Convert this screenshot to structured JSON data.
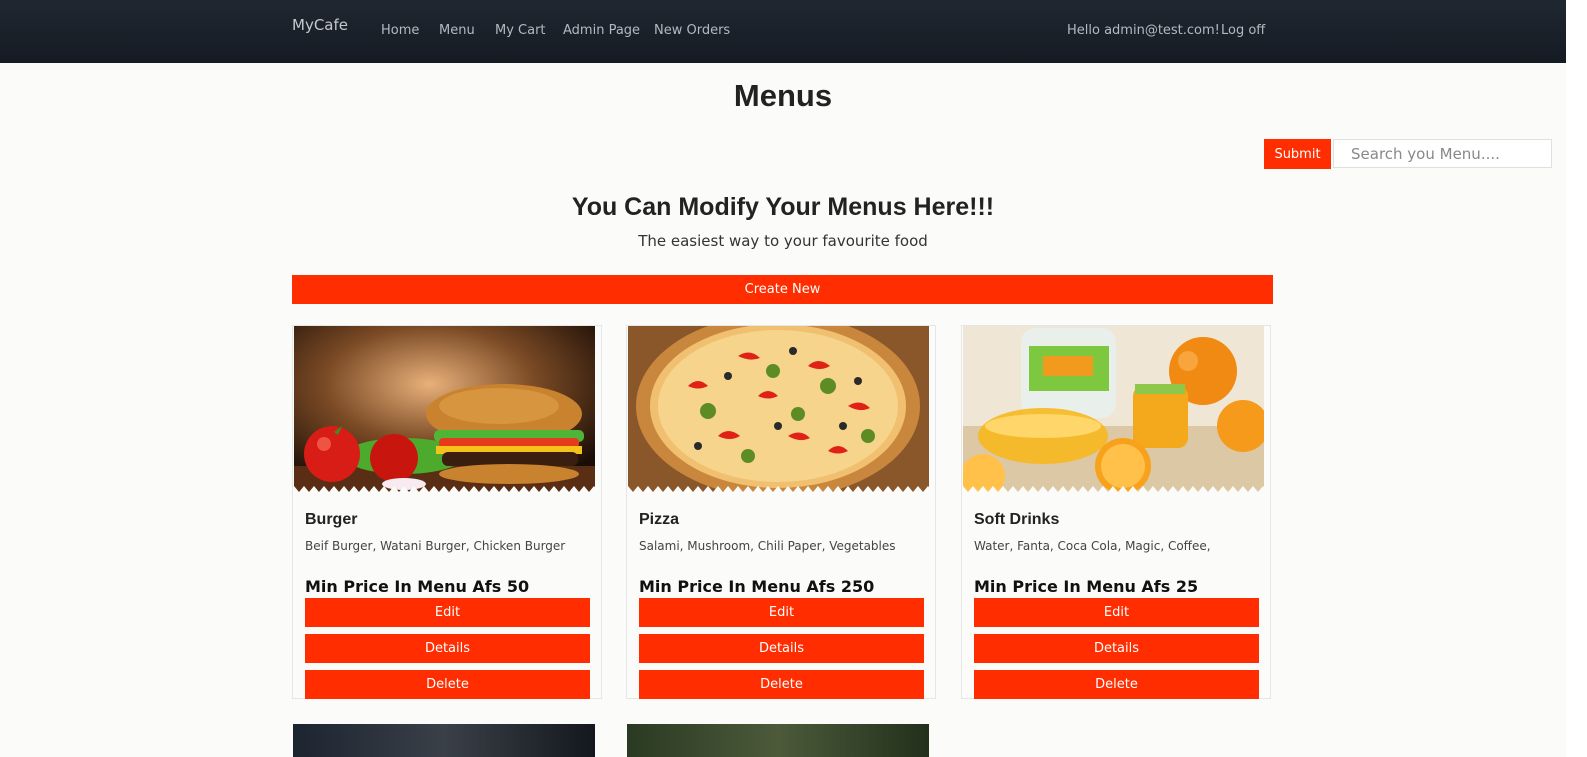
{
  "nav": {
    "brand": "MyCafe",
    "links": [
      "Home",
      "Menu",
      "My Cart",
      "Admin Page",
      "New Orders"
    ],
    "greeting": "Hello admin@test.com!",
    "logoff": "Log off"
  },
  "page": {
    "title": "Menus",
    "search_button": "Submit",
    "search_placeholder": "Search you Menu....",
    "hero_title": "You Can Modify Your Menus Here!!!",
    "hero_subtitle": "The easiest way to your favourite food",
    "create_button": "Create New"
  },
  "menus": [
    {
      "name": "Burger",
      "items": "Beif Burger, Watani Burger, Chicken Burger",
      "price": "Min Price In Menu Afs 50",
      "edit": "Edit",
      "details": "Details",
      "delete": "Delete"
    },
    {
      "name": "Pizza",
      "items": "Salami, Mushroom, Chili Paper, Vegetables",
      "price": "Min Price In Menu Afs 250",
      "edit": "Edit",
      "details": "Details",
      "delete": "Delete"
    },
    {
      "name": "Soft Drinks",
      "items": "Water, Fanta, Coca Cola, Magic, Coffee,",
      "price": "Min Price In Menu Afs 25",
      "edit": "Edit",
      "details": "Details",
      "delete": "Delete"
    }
  ],
  "colors": {
    "accent": "#ff2d00",
    "navbar": "#1a212a"
  }
}
